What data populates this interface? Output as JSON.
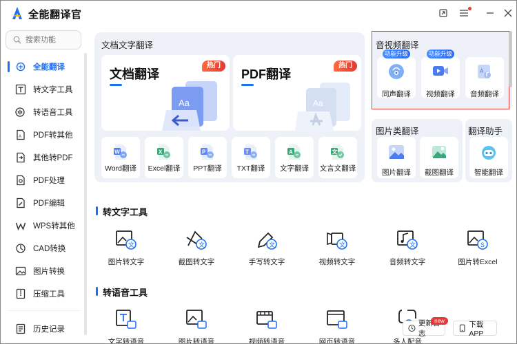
{
  "app": {
    "title": "全能翻译官"
  },
  "window": {
    "icons": [
      "pin-icon",
      "menu-icon",
      "minimize-icon",
      "close-icon"
    ]
  },
  "search": {
    "placeholder": "搜索功能"
  },
  "sidebar": {
    "items": [
      {
        "label": "全能翻译",
        "icon": "translate-icon",
        "active": true
      },
      {
        "label": "转文字工具",
        "icon": "text-tool-icon"
      },
      {
        "label": "转语音工具",
        "icon": "voice-tool-icon"
      },
      {
        "label": "PDF转其他",
        "icon": "pdf-convert-icon"
      },
      {
        "label": "其他转PDF",
        "icon": "to-pdf-icon"
      },
      {
        "label": "PDF处理",
        "icon": "pdf-process-icon"
      },
      {
        "label": "PDF编辑",
        "icon": "pdf-edit-icon"
      },
      {
        "label": "WPS转其他",
        "icon": "wps-icon"
      },
      {
        "label": "CAD转换",
        "icon": "cad-icon"
      },
      {
        "label": "图片转换",
        "icon": "image-convert-icon"
      },
      {
        "label": "压缩工具",
        "icon": "compress-icon"
      },
      {
        "label": "历史记录",
        "icon": "history-icon"
      }
    ]
  },
  "doc": {
    "title": "文档文字翻译",
    "big": [
      {
        "label": "文档翻译",
        "badge": "热门"
      },
      {
        "label": "PDF翻译",
        "badge": "热门"
      }
    ],
    "small": [
      "Word翻译",
      "Excel翻译",
      "PPT翻译",
      "TXT翻译",
      "文字翻译",
      "文言文翻译"
    ]
  },
  "av": {
    "title": "音视频翻译",
    "items": [
      {
        "label": "同声翻译",
        "badge": "功能升级"
      },
      {
        "label": "视频翻译",
        "badge": "功能升级"
      },
      {
        "label": "音频翻译",
        "badge": ""
      }
    ]
  },
  "img": {
    "title": "图片类翻译",
    "items": [
      "图片翻译",
      "截图翻译"
    ]
  },
  "helper": {
    "title": "翻译助手",
    "items": [
      "智能翻译"
    ]
  },
  "text_tools": {
    "title": "转文字工具",
    "items": [
      "图片转文字",
      "截图转文字",
      "手写转文字",
      "视频转文字",
      "音频转文字",
      "图片转Excel"
    ]
  },
  "voice_tools": {
    "title": "转语音工具",
    "items": [
      "文字转语音",
      "图片转语音",
      "视频转语音",
      "网页转语音",
      "多人配音"
    ]
  },
  "footer": {
    "changelog": "更新日志",
    "new_badge": "new",
    "download": "下载APP"
  },
  "colors": {
    "accent": "#1d6ff2",
    "hot": "#e53935",
    "panel": "#eef2f8"
  }
}
